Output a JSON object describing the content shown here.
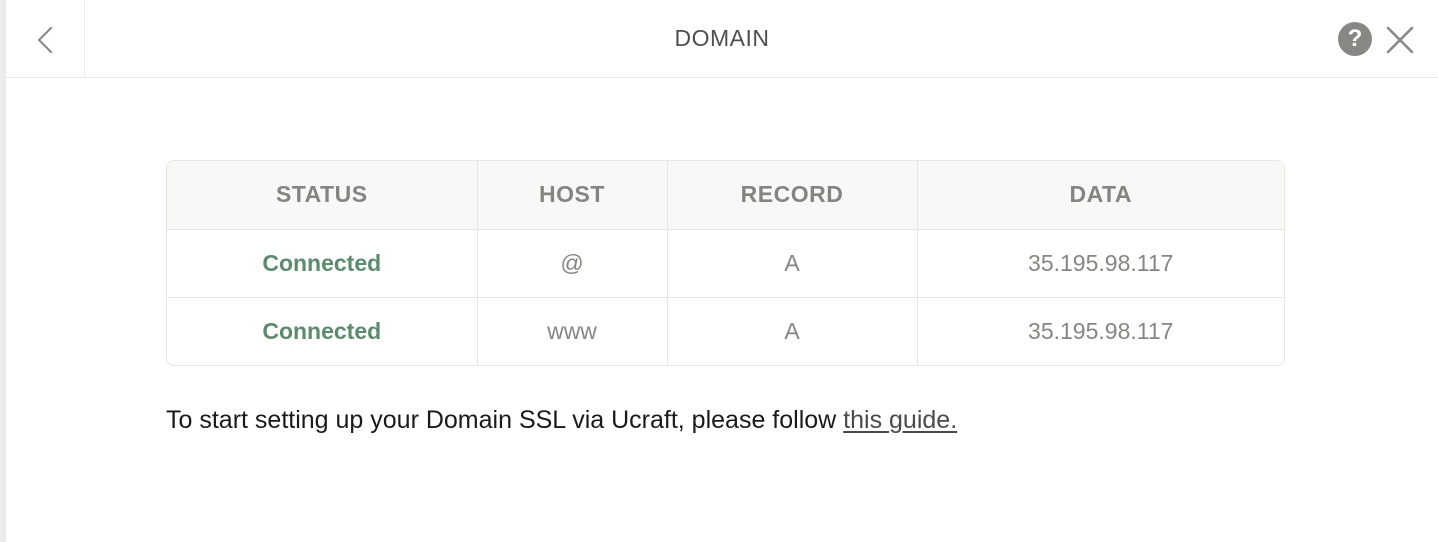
{
  "header": {
    "title": "DOMAIN",
    "help_icon": "question-circle-icon",
    "close_icon": "close-x-icon",
    "back_icon": "chevron-left-icon"
  },
  "table": {
    "columns": [
      "STATUS",
      "HOST",
      "RECORD",
      "DATA"
    ],
    "rows": [
      {
        "status": "Connected",
        "host": "@",
        "record": "A",
        "data": "35.195.98.117"
      },
      {
        "status": "Connected",
        "host": "www",
        "record": "A",
        "data": "35.195.98.117"
      }
    ]
  },
  "info": {
    "text": "To start setting up your Domain SSL via Ucraft, please follow ",
    "link_label": "this guide."
  },
  "colors": {
    "status_connected": "#5a8c6c",
    "help_icon_bg": "#878783"
  }
}
